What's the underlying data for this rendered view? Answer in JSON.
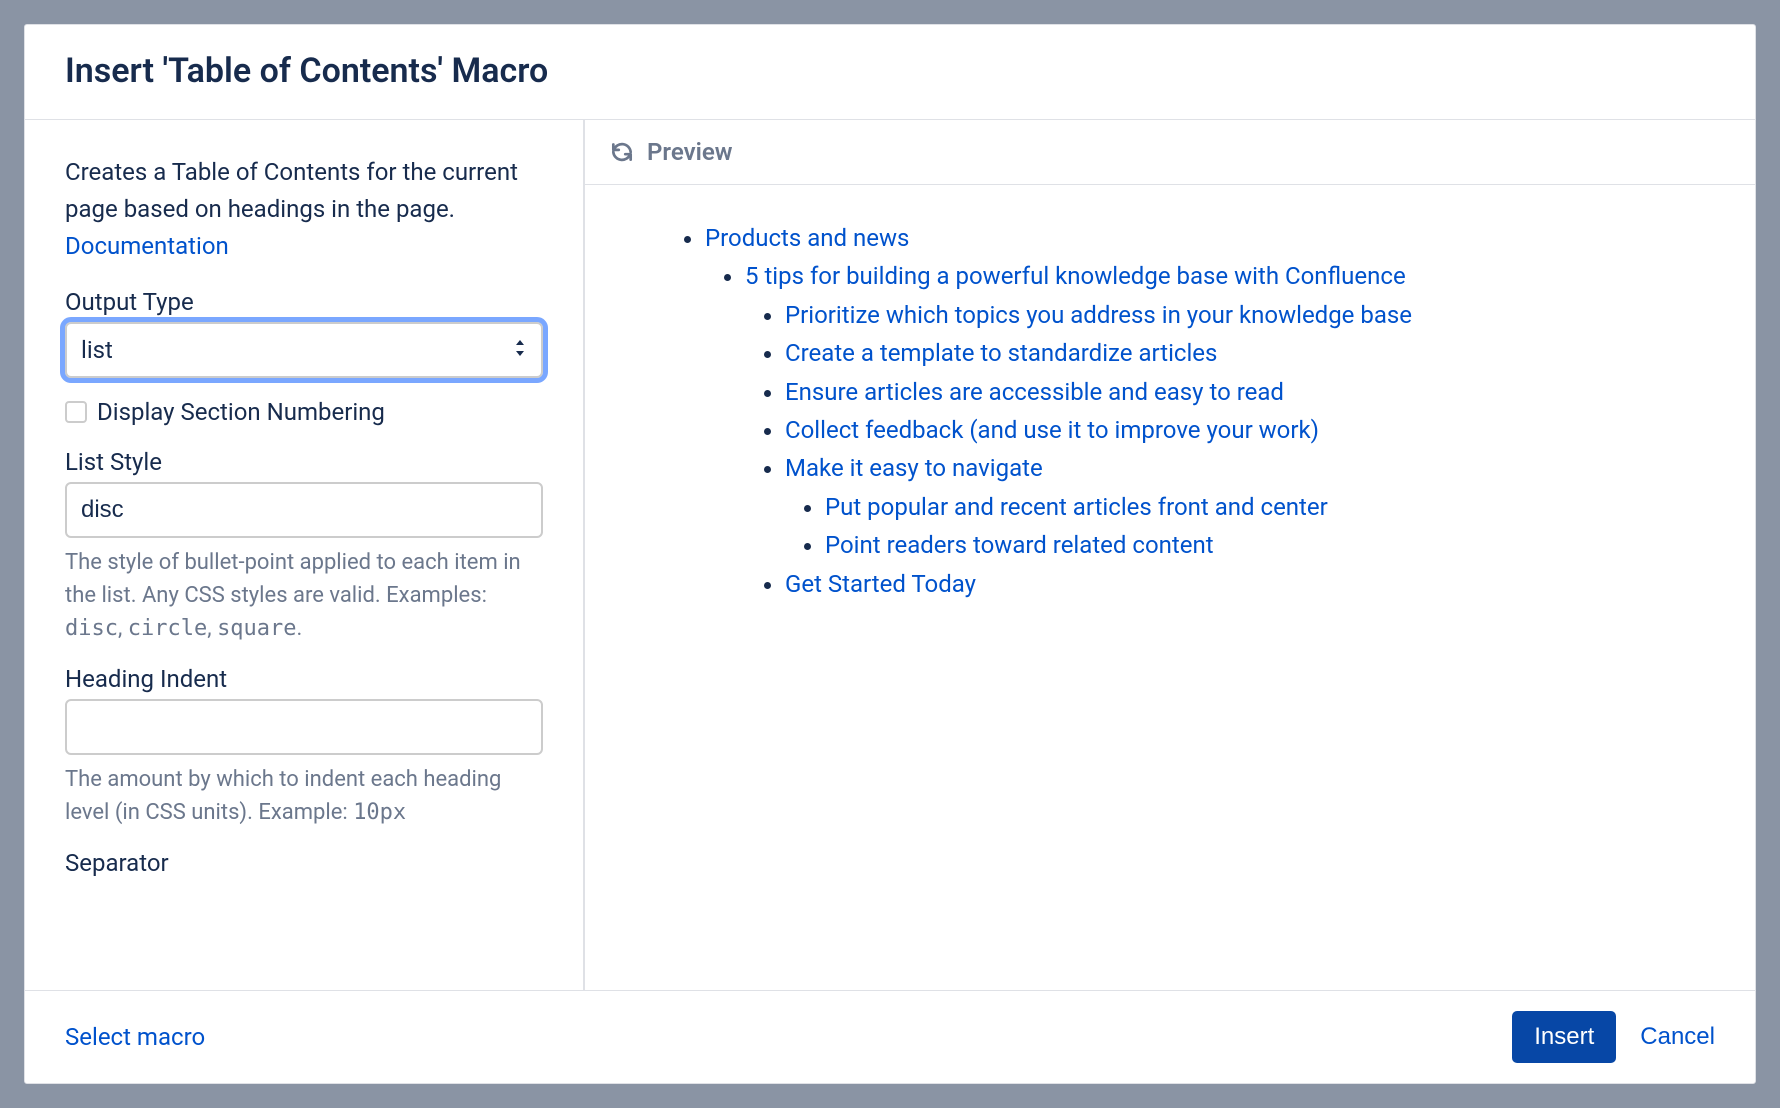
{
  "dialog": {
    "title": "Insert 'Table of Contents' Macro"
  },
  "form": {
    "description_prefix": "Creates a Table of Contents for the current page based on headings in the page. ",
    "doc_link_label": "Documentation",
    "output_type": {
      "label": "Output Type",
      "value": "list"
    },
    "display_section_numbering": {
      "label": "Display Section Numbering",
      "checked": false
    },
    "list_style": {
      "label": "List Style",
      "value": "disc",
      "help_prefix": "The style of bullet-point applied to each item in the list. Any CSS styles are valid. Examples: ",
      "example1": "disc",
      "sep1": ", ",
      "example2": "circle",
      "sep2": ", ",
      "example3": "square",
      "suffix": "."
    },
    "heading_indent": {
      "label": "Heading Indent",
      "value": "",
      "help_prefix": "The amount by which to indent each heading level (in CSS units). Example: ",
      "example": "10px"
    },
    "separator": {
      "label": "Separator"
    }
  },
  "preview": {
    "header": "Preview",
    "l1_0": "Products and news",
    "l2_0": "5 tips for building a powerful knowledge base with Confluence",
    "l3_0": "Prioritize which topics you address in your knowledge base",
    "l3_1": "Create a template to standardize articles",
    "l3_2": "Ensure articles are accessible and easy to read",
    "l3_3": "Collect feedback (and use it to improve your work)",
    "l3_4": "Make it easy to navigate",
    "l4_0": "Put popular and recent articles front and center",
    "l4_1": "Point readers toward related content",
    "l3_5": "Get Started Today"
  },
  "footer": {
    "select_macro": "Select macro",
    "insert": "Insert",
    "cancel": "Cancel"
  }
}
